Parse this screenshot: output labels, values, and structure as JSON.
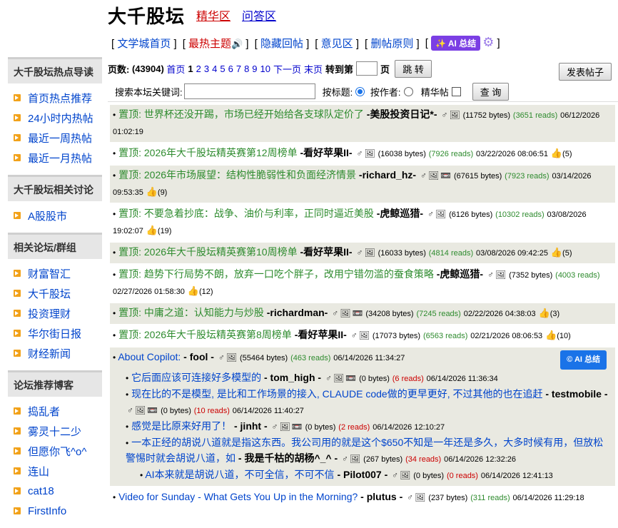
{
  "site": {
    "title": "大千股坛",
    "links": [
      "精华区",
      "问答区"
    ]
  },
  "nav": [
    {
      "label": "文学城首页",
      "red": false
    },
    {
      "label": "最热主题",
      "red": true
    },
    {
      "label": "隐藏回帖",
      "red": false
    },
    {
      "label": "意见区",
      "red": false
    },
    {
      "label": "删帖原则",
      "red": false
    }
  ],
  "ai_summary_label": "AI 总结",
  "pager": {
    "label": "页数:",
    "count": "(43904)",
    "first": "首页",
    "current": "1",
    "pages": [
      "2",
      "3",
      "4",
      "5",
      "6",
      "7",
      "8",
      "9",
      "10"
    ],
    "next": "下一页",
    "last": "末页",
    "goto": "转到第",
    "page_unit": "页",
    "jump_button": "跳 转"
  },
  "post_button": "发表帖子",
  "search": {
    "label": "搜索本坛关键词:",
    "by_title": "按标题:",
    "by_author": "按作者:",
    "featured": "精华帖",
    "button": "查 询"
  },
  "sidebar": [
    {
      "heading": "大千股坛热点导读",
      "items": [
        "首页热点推荐",
        "24小时内热帖",
        "最近一周热帖",
        "最近一月热帖"
      ]
    },
    {
      "heading": "大千股坛相关讨论",
      "items": [
        "A股股市"
      ]
    },
    {
      "heading": "相关论坛/群组",
      "items": [
        "财富智汇",
        "大千股坛",
        "投资理财",
        "华尔街日报",
        "财经新闻"
      ]
    },
    {
      "heading": "论坛推荐博客",
      "items": [
        "捣乱者",
        "雾灵十二少",
        "但愿你飞^o^",
        "连山",
        "cat18",
        "FirstInfo"
      ]
    }
  ],
  "posts": [
    {
      "title": "置顶: 世界杯还没开踢，市场已经开始给各支球队定价了",
      "author": "-美股投资日记*-",
      "bytes": "(11752 bytes)",
      "reads": "(3651 reads)",
      "date": "06/12/2026  01:02:19",
      "likes": ""
    },
    {
      "title": "置顶: 2026年大千股坛精英赛第12周榜单",
      "author": "-看好苹果II-",
      "bytes": "(16038 bytes)",
      "reads": "(7926 reads)",
      "date": "03/22/2026  08:06:51",
      "likes": "(5)"
    },
    {
      "title": "置顶: 2026年市场展望：结构性脆弱性和负面经济情景",
      "author": "-richard_hz-",
      "bytes": "(67615 bytes)",
      "reads": "(7923 reads)",
      "date": "03/14/2026  09:53:35",
      "likes": "(9)"
    },
    {
      "title": "置顶: 不要急着抄底：战争、油价与利率，正同时逼近美股",
      "author": "-虎鲸巡猎-",
      "bytes": "(6126 bytes)",
      "reads": "(10302 reads)",
      "date": "03/08/2026  19:02:07",
      "likes": "(19)"
    },
    {
      "title": "置顶: 2026年大千股坛精英赛第10周榜单",
      "author": "-看好苹果II-",
      "bytes": "(16033 bytes)",
      "reads": "(4814 reads)",
      "date": "03/08/2026  09:42:25",
      "likes": "(5)"
    },
    {
      "title": "置顶: 趋势下行局势不朗，放弃一口吃个胖子，改用宁错勿滥的蚕食策略",
      "author": "-虎鲸巡猎-",
      "bytes": "(7352 bytes)",
      "reads": "(4003 reads)",
      "date": "02/27/2026  01:58:30",
      "likes": "(12)"
    },
    {
      "title": "置顶: 中庸之道：认知能力与炒股",
      "author": "-richardman-",
      "bytes": "(34208 bytes)",
      "reads": "(7245 reads)",
      "date": "02/22/2026  04:38:03",
      "likes": "(3)"
    },
    {
      "title": "置顶: 2026年大千股坛精英赛第8周榜单",
      "author": "-看好苹果II-",
      "bytes": "(17073 bytes)",
      "reads": "(6563 reads)",
      "date": "02/21/2026  08:06:53",
      "likes": "(10)"
    }
  ],
  "thread": {
    "title": "About Copilot:",
    "author": "- fool -",
    "bytes": "(55464 bytes)",
    "reads": "(463 reads)",
    "date": "06/14/2026  11:34:27",
    "replies": [
      {
        "title": "它后面应该可连接好多模型的",
        "author": "- tom_high -",
        "bytes": "(0 bytes)",
        "reads": "(6 reads)",
        "date": "06/14/2026  11:36:34"
      },
      {
        "title": "现在比的不是模型, 是比和工作场景的接入, CLAUDE code做的更早更好, 不过其他的也在追赶",
        "author": "- testmobile -",
        "bytes": "(0 bytes)",
        "reads": "(10 reads)",
        "date": "06/14/2026  11:40:27"
      },
      {
        "title": "感觉是比原来好用了！",
        "author": "- jinht -",
        "bytes": "(0 bytes)",
        "reads": "(2 reads)",
        "date": "06/14/2026  12:10:27"
      },
      {
        "title": "一本正经的胡说八道就是指这东西。我公司用的就是这个$650不知是一年还是多久，大多时候有用，但放松警惕时就会胡说八道，如",
        "author": "- 我是千枯的胡杨^_^ -",
        "bytes": "(267 bytes)",
        "reads": "(34 reads)",
        "date": "06/14/2026  12:32:26"
      }
    ],
    "sub_reply": {
      "title": "AI本来就是胡说八道，不可全信，不可不信",
      "author": "- Pilot007 -",
      "bytes": "(0 bytes)",
      "reads": "(0 reads)",
      "date": "06/14/2026  12:41:13"
    }
  },
  "last_post": {
    "title": "Video for Sunday - What Gets You Up in the Morning?",
    "author": "- plutus -",
    "bytes": "(237 bytes)",
    "reads": "(311 reads)",
    "date": "06/14/2026  11:29:18"
  }
}
